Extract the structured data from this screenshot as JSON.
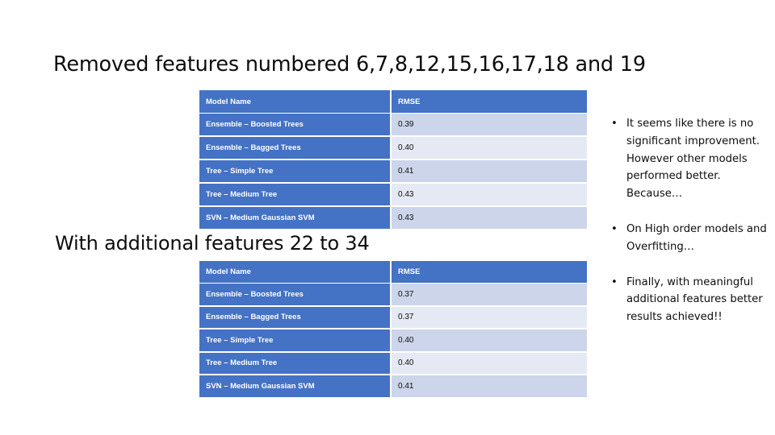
{
  "slide": {
    "background_color": "#ffffff",
    "accent_color": "#4472c4",
    "band_dark_color": "#ccd5ea",
    "band_light_color": "#e5e9f3",
    "text_color": "#0d0d0d"
  },
  "headings": {
    "first": "Removed features numbered 6,7,8,12,15,16,17,18 and 19",
    "second": "With additional features 22 to 34"
  },
  "tables": [
    {
      "id": "table-1",
      "columns": [
        "Model Name",
        "RMSE"
      ],
      "rows": [
        {
          "model": "Ensemble – Boosted Trees",
          "rmse": "0.39"
        },
        {
          "model": "Ensemble – Bagged Trees",
          "rmse": "0.40"
        },
        {
          "model": "Tree – Simple Tree",
          "rmse": "0.41"
        },
        {
          "model": "Tree – Medium Tree",
          "rmse": "0.43"
        },
        {
          "model": "SVN – Medium Gaussian SVM",
          "rmse": "0.43"
        }
      ]
    },
    {
      "id": "table-2",
      "columns": [
        "Model Name",
        "RMSE"
      ],
      "rows": [
        {
          "model": "Ensemble – Boosted Trees",
          "rmse": "0.37"
        },
        {
          "model": "Ensemble – Bagged Trees",
          "rmse": "0.37"
        },
        {
          "model": "Tree – Simple Tree",
          "rmse": "0.40"
        },
        {
          "model": "Tree – Medium Tree",
          "rmse": "0.40"
        },
        {
          "model": "SVN – Medium Gaussian SVM",
          "rmse": "0.41"
        }
      ]
    }
  ],
  "bullets": {
    "marker": "•",
    "items": [
      "It seems like there is no significant improvement. However other models performed better. Because…",
      "On High order models and Overfitting…",
      "Finally, with meaningful additional features better results achieved!!"
    ]
  }
}
